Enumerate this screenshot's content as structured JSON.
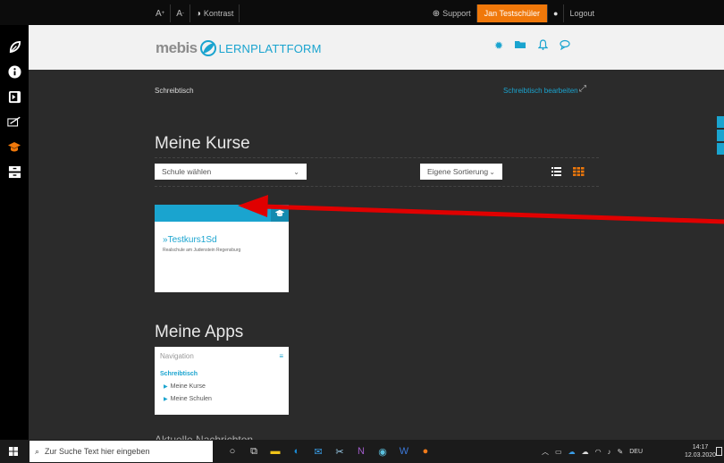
{
  "topbar": {
    "font_increase": "A",
    "font_decrease": "A",
    "contrast_label": "Kontrast",
    "support_label": "Support",
    "user_name": "Jan Testschüler",
    "logout_label": "Logout"
  },
  "sidebar": {
    "icons": [
      "mebis-leaf-icon",
      "info-icon",
      "media-icon",
      "notebook-icon",
      "graduation-cap-icon",
      "archive-icon"
    ]
  },
  "header": {
    "brand": "mebis",
    "platform": "LERNPLATTFORM",
    "icons": [
      "gear-icon",
      "folder-icon",
      "bell-icon",
      "chat-icon"
    ]
  },
  "breadcrumb": "Schreibtisch",
  "edit_desk_label": "Schreibtisch bearbeiten",
  "courses": {
    "title": "Meine Kurse",
    "school_select": "Schule wählen",
    "sort_select": "Eigene Sortierung",
    "card": {
      "title_prefix": "»",
      "title": "Testkurs1Sd",
      "subtitle": "Realschule am Judenstein Regensburg"
    }
  },
  "apps": {
    "title": "Meine Apps",
    "card_title": "Navigation",
    "desk_label": "Schreibtisch",
    "items": [
      "Meine Kurse",
      "Meine Schulen"
    ]
  },
  "next_section_peek": "Aktuelle Nachrichten",
  "taskbar": {
    "search_placeholder": "Zur Suche Text hier eingeben",
    "language": "DEU",
    "time": "14:17",
    "date": "12.03.2020"
  },
  "colors": {
    "accent": "#1aa4cf",
    "user_orange": "#f0780a",
    "arrow_red": "#e00000",
    "grid_orange": "#f0780a"
  }
}
